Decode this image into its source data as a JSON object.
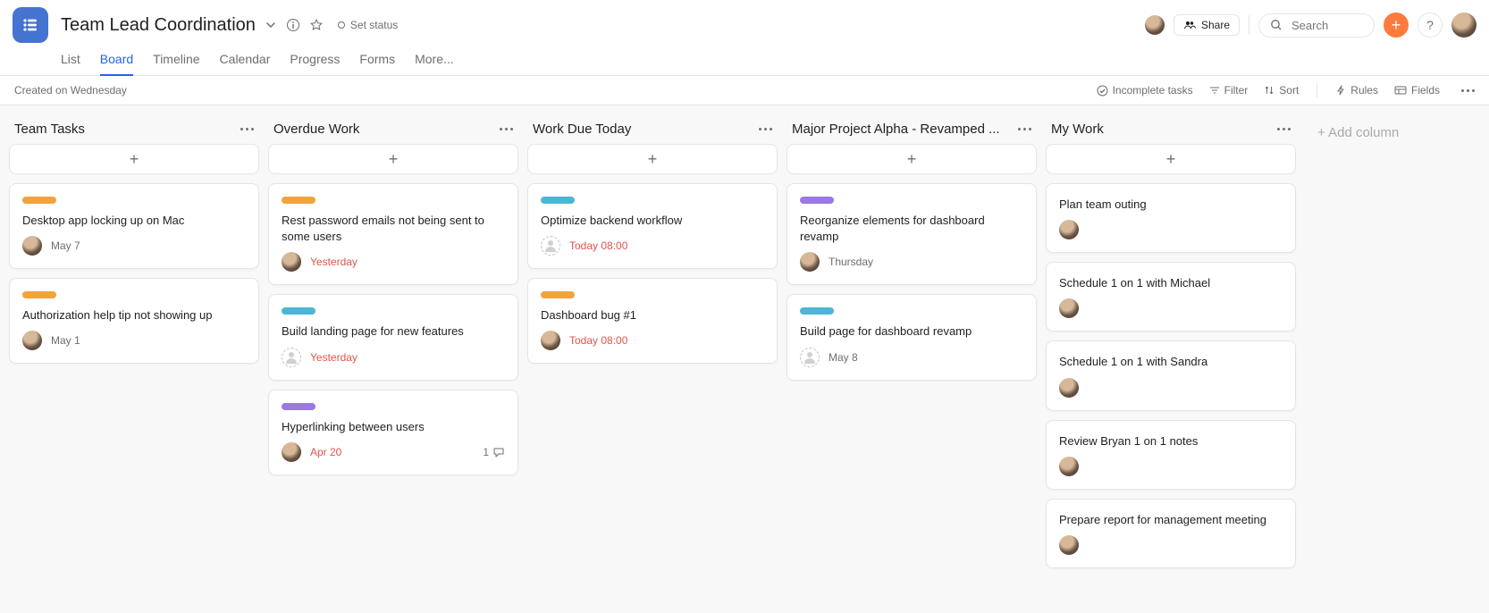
{
  "header": {
    "title": "Team Lead Coordination",
    "set_status": "Set status",
    "share": "Share",
    "search_placeholder": "Search",
    "tabs": [
      "List",
      "Board",
      "Timeline",
      "Calendar",
      "Progress",
      "Forms",
      "More..."
    ],
    "active_tab": "Board"
  },
  "toolbar": {
    "created": "Created on Wednesday",
    "incomplete": "Incomplete tasks",
    "filter": "Filter",
    "sort": "Sort",
    "rules": "Rules",
    "fields": "Fields"
  },
  "add_column": "+ Add column",
  "colors": {
    "orange": "#f1a33c",
    "teal": "#4cb6d6",
    "purple": "#9b78e2",
    "red": "#e0544c"
  },
  "columns": [
    {
      "title": "Team Tasks",
      "cards": [
        {
          "pill": "orange",
          "title": "Desktop app locking up on Mac",
          "assignee": "user",
          "date": "May 7"
        },
        {
          "pill": "orange",
          "title": "Authorization help tip not showing up",
          "assignee": "user",
          "date": "May 1"
        }
      ]
    },
    {
      "title": "Overdue Work",
      "cards": [
        {
          "pill": "orange",
          "title": "Rest password emails not being sent to some users",
          "assignee": "user",
          "date": "Yesterday",
          "overdue": true
        },
        {
          "pill": "teal",
          "title": "Build landing page for new features",
          "assignee": "none",
          "date": "Yesterday",
          "overdue": true
        },
        {
          "pill": "purple",
          "title": "Hyperlinking between users",
          "assignee": "user",
          "date": "Apr 20",
          "overdue": true,
          "comments": 1
        }
      ]
    },
    {
      "title": "Work Due Today",
      "cards": [
        {
          "pill": "teal",
          "title": "Optimize backend workflow",
          "assignee": "none",
          "date": "Today 08:00",
          "overdue": true
        },
        {
          "pill": "orange",
          "title": "Dashboard bug #1",
          "assignee": "user",
          "date": "Today 08:00",
          "overdue": true
        }
      ]
    },
    {
      "title": "Major Project Alpha - Revamped ...",
      "cards": [
        {
          "pill": "purple",
          "title": "Reorganize elements for dashboard revamp",
          "assignee": "user",
          "date": "Thursday"
        },
        {
          "pill": "teal",
          "title": "Build page for dashboard revamp",
          "assignee": "none",
          "date": "May 8"
        }
      ]
    },
    {
      "title": "My Work",
      "cards": [
        {
          "title": "Plan team outing",
          "assignee": "user"
        },
        {
          "title": "Schedule 1 on 1 with Michael",
          "assignee": "user"
        },
        {
          "title": "Schedule 1 on 1 with Sandra",
          "assignee": "user"
        },
        {
          "title": "Review Bryan 1 on 1 notes",
          "assignee": "user"
        },
        {
          "title": "Prepare report for management meeting",
          "assignee": "user"
        }
      ]
    }
  ]
}
